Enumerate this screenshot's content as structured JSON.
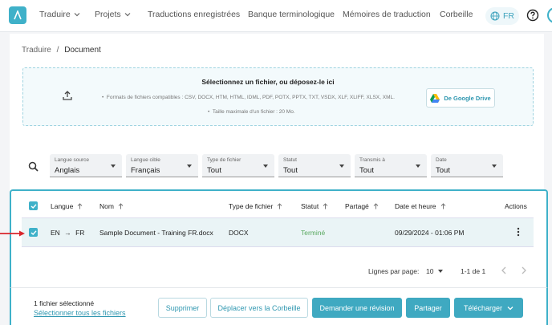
{
  "nav": {
    "items": [
      {
        "label": "Traduire",
        "dropdown": true
      },
      {
        "label": "Projets",
        "dropdown": true
      },
      {
        "label": "Traductions enregistrées"
      },
      {
        "label": "Banque terminologique"
      },
      {
        "label": "Mémoires de traduction"
      },
      {
        "label": "Corbeille"
      }
    ],
    "language": "FR"
  },
  "breadcrumb": {
    "parent": "Traduire",
    "separator": "/",
    "current": "Document"
  },
  "dropzone": {
    "title": "Sélectionnez un fichier, ou déposez-le ici",
    "formats": "Formats de fichiers compatibles : CSV, DOCX, HTM, HTML, IDML, PDF, POTX, PPTX, TXT, VSDX, XLF, XLIFF, XLSX, XML.",
    "max_size": "Taille maximale d'un fichier : 20 Mo.",
    "gdrive_label": "De Google Drive"
  },
  "filters": [
    {
      "label": "Langue source",
      "value": "Anglais"
    },
    {
      "label": "Langue cible",
      "value": "Français"
    },
    {
      "label": "Type de fichier",
      "value": "Tout"
    },
    {
      "label": "Statut",
      "value": "Tout"
    },
    {
      "label": "Transmis à",
      "value": "Tout"
    },
    {
      "label": "Date",
      "value": "Tout"
    }
  ],
  "table": {
    "headers": {
      "langue": "Langue",
      "nom": "Nom",
      "type": "Type de fichier",
      "statut": "Statut",
      "partage": "Partagé",
      "date": "Date et heure",
      "actions": "Actions"
    },
    "rows": [
      {
        "src": "EN",
        "arrow": "→",
        "tgt": "FR",
        "name": "Sample Document - Training FR.docx",
        "type": "DOCX",
        "status": "Terminé",
        "date": "09/29/2024 - 01:06 PM"
      }
    ]
  },
  "pager": {
    "label": "Lignes par page:",
    "per_page": "10",
    "range": "1-1 de 1"
  },
  "actions": {
    "selected_count": "1 fichier sélectionné",
    "select_all": "Sélectionner tous les fichiers",
    "delete": "Supprimer",
    "move_trash": "Déplacer vers la Corbeille",
    "request_review": "Demander une révision",
    "share": "Partager",
    "download": "Télécharger"
  },
  "colors": {
    "accent": "#3fb1c9",
    "status_done": "#59a85f",
    "annotation": "#d9262c"
  }
}
